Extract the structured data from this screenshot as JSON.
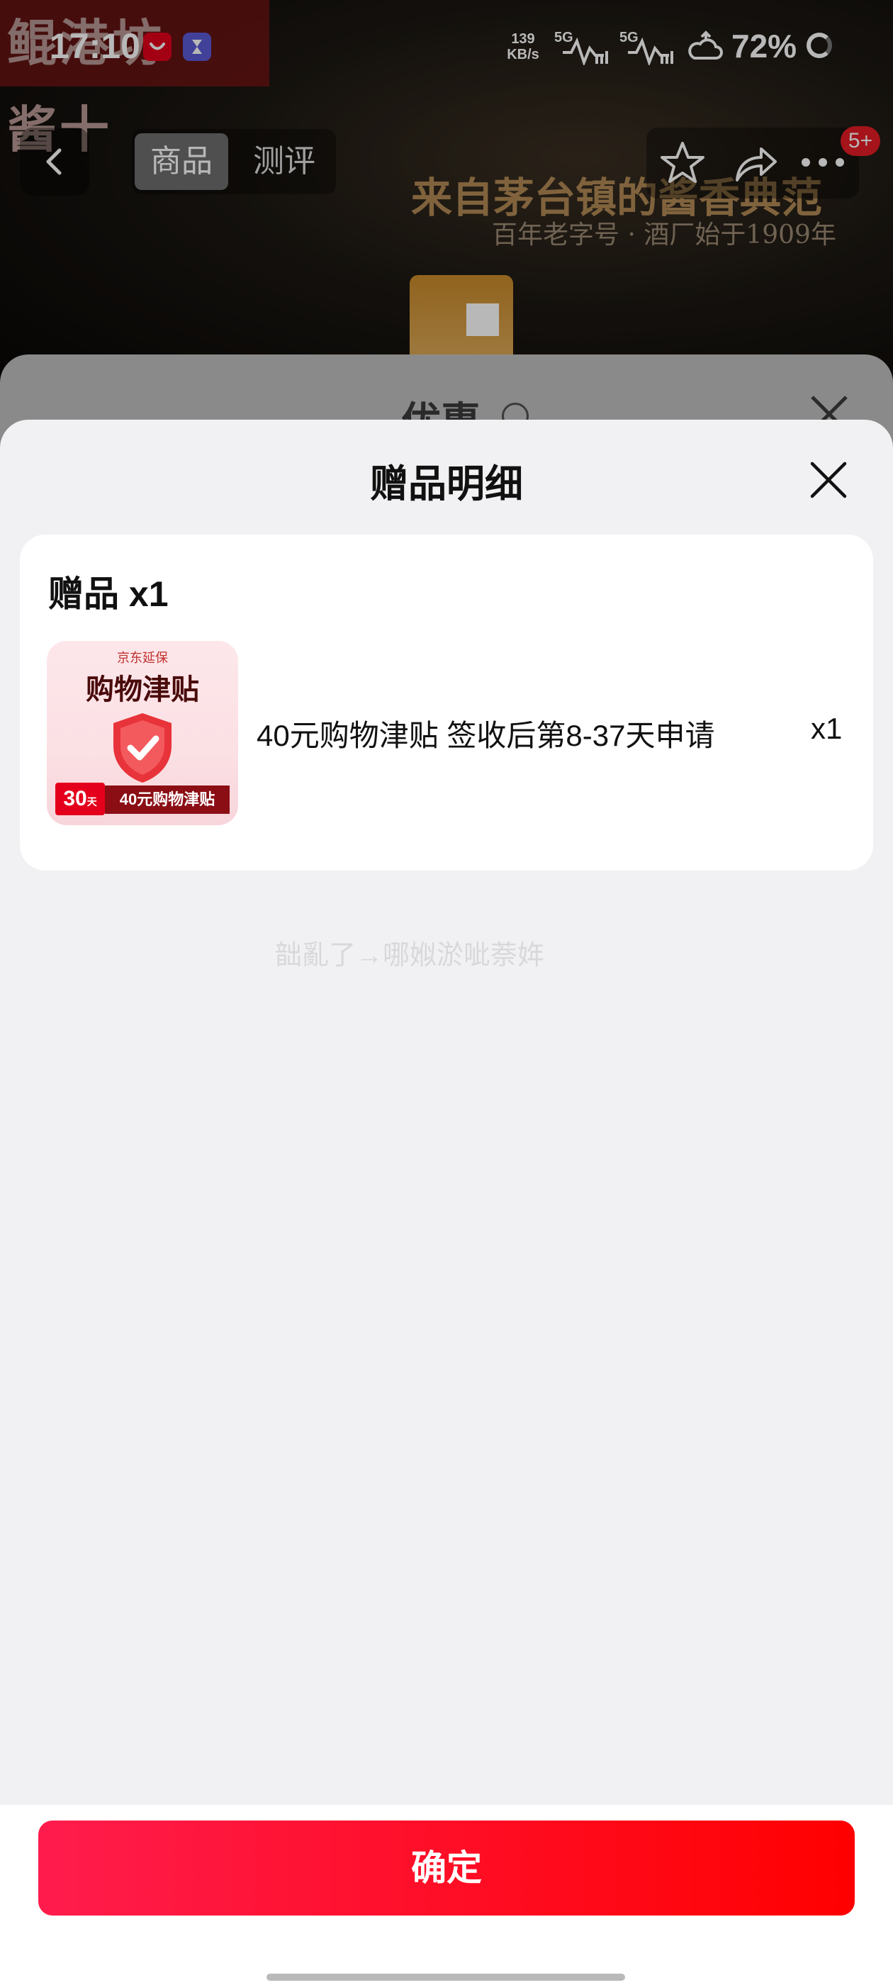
{
  "status_bar": {
    "time": "17:10",
    "net_speed_value": "139",
    "net_speed_unit": "KB/s",
    "sim1": "5G",
    "sim2": "5G",
    "battery": "72%"
  },
  "background_page": {
    "shop_name": "鲲港坊 · 酱十",
    "tabs": [
      {
        "label": "商品"
      },
      {
        "label": "测评"
      }
    ],
    "badge": "5+",
    "banner_title": "来自茅台镇的酱香典范",
    "banner_subtitle": "百年老字号 · 酒厂始于1909年",
    "previous_sheet_title": "优惠"
  },
  "sheet": {
    "title": "赠品明细",
    "card_header": "赠品 x1",
    "gift": {
      "image_brand": "京东延保",
      "image_heading": "购物津贴",
      "image_days": "30",
      "image_days_unit": "天",
      "image_amount": "40元购物津贴",
      "name": "40元购物津贴 签收后第8-37天申请",
      "quantity": "x1"
    },
    "garbled_text": "韷亂了→哪娰淤呲萘姩",
    "confirm_label": "确定"
  },
  "colors": {
    "confirm_start": "#ff1c4d",
    "confirm_end": "#ff0000",
    "sheet_bg": "#f1f1f3",
    "badge": "#e31c25"
  }
}
